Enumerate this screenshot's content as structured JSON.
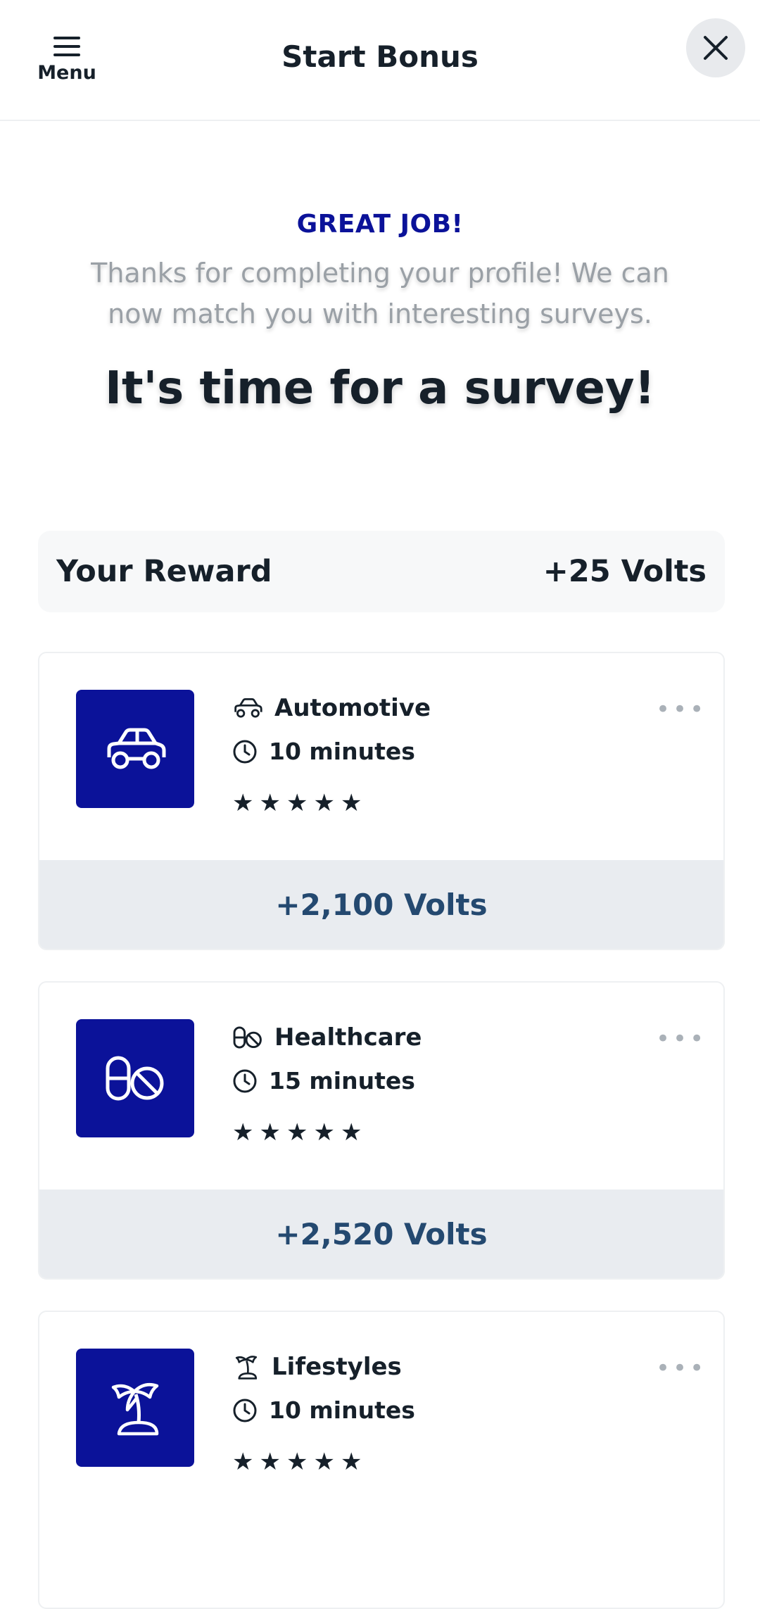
{
  "header": {
    "menu_label": "Menu",
    "title": "Start Bonus"
  },
  "hero": {
    "kicker": "GREAT JOB!",
    "subtext": "Thanks for completing your profile! We can now match you with interesting surveys.",
    "headline": "It's time for a survey!"
  },
  "reward": {
    "label": "Your Reward",
    "value": "+25 Volts"
  },
  "surveys": [
    {
      "category": "Automotive",
      "icon": "car-icon",
      "duration": "10 minutes",
      "rating": 5,
      "reward": "+2,100 Volts"
    },
    {
      "category": "Healthcare",
      "icon": "pill-icon",
      "duration": "15 minutes",
      "rating": 5,
      "reward": "+2,520 Volts"
    },
    {
      "category": "Lifestyles",
      "icon": "palm-tree-icon",
      "duration": "10 minutes",
      "rating": 5,
      "reward": ""
    }
  ],
  "colors": {
    "brand": "#0b1299",
    "points_text": "#244970",
    "points_bg": "#e9ecf0"
  }
}
